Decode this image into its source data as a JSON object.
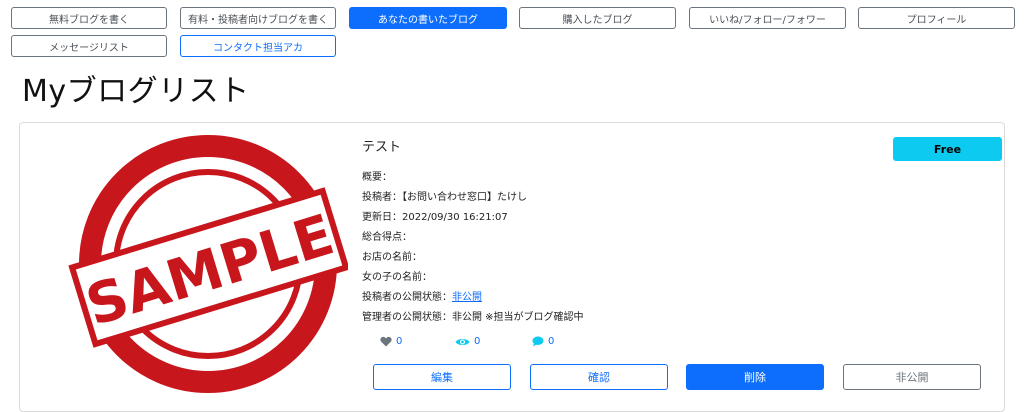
{
  "nav": {
    "row1": [
      {
        "label": "無料ブログを書く"
      },
      {
        "label": "有料・投稿者向けブログを書く"
      },
      {
        "label": "あなたの書いたブログ"
      },
      {
        "label": "購入したブログ"
      },
      {
        "label": "いいね/フォロー/フォワー"
      },
      {
        "label": "プロフィール"
      }
    ],
    "row2": [
      {
        "label": "メッセージリスト"
      },
      {
        "label": "コンタクト担当アカ"
      }
    ]
  },
  "page": {
    "title": "Myブログリスト"
  },
  "post": {
    "image_text": "SAMPLE",
    "title": "テスト",
    "badge": "Free",
    "summary_label": "概要：",
    "poster_label": "投稿者：",
    "poster_value": "【お問い合わせ窓口】たけし",
    "updated_label": "更新日：",
    "updated_value": "2022/09/30 16:21:07",
    "score_label": "総合得点：",
    "shop_label": "お店の名前：",
    "girl_label": "女の子の名前：",
    "poster_status_label": "投稿者の公開状態：",
    "poster_status_value": "非公開",
    "admin_status_label": "管理者の公開状態：",
    "admin_status_value": "非公開 ※担当がブログ確認中",
    "likes": "0",
    "views": "0",
    "comments": "0"
  },
  "actions": {
    "edit": "編集",
    "confirm": "確認",
    "delete": "削除",
    "hide": "非公開"
  },
  "colors": {
    "primary": "#0d6efd",
    "info": "#0dcaf0",
    "stamp_red": "#c8161d"
  }
}
